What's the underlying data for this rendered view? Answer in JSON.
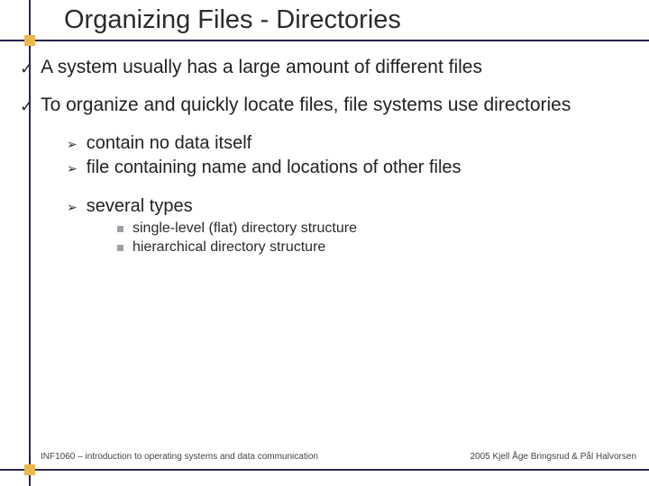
{
  "title": "Organizing Files - Directories",
  "bullets": {
    "b1a": "A system usually has a large amount of different files",
    "b1b": "To organize and quickly locate files, file systems use directories",
    "b2a": "contain no data itself",
    "b2b": "file containing name and locations of other files",
    "b2c": "several types",
    "b3a": "single-level (flat) directory structure",
    "b3b": "hierarchical directory structure"
  },
  "footer": {
    "left": "INF1060 – introduction to operating systems and data communication",
    "right": "2005 Kjell Åge Bringsrud & Pål Halvorsen"
  }
}
